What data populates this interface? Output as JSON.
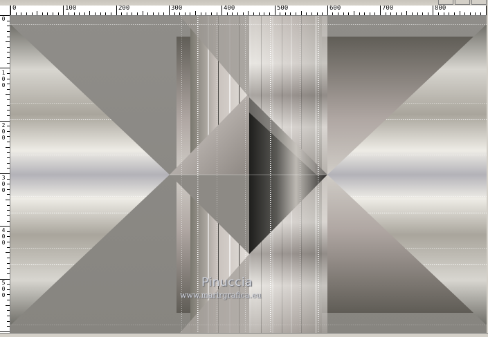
{
  "ruler": {
    "h_labels": [
      "0",
      "100",
      "200",
      "300",
      "400",
      "500",
      "600",
      "700",
      "800"
    ],
    "v_labels": [
      [
        "0"
      ],
      [
        "1",
        "0",
        "0"
      ],
      [
        "2",
        "0",
        "0"
      ],
      [
        "3",
        "0",
        "0"
      ],
      [
        "4",
        "0",
        "0"
      ],
      [
        "5",
        "0",
        "0"
      ]
    ]
  },
  "canvas": {
    "watermark_name": "Pinuccia",
    "watermark_url": "www.marirgrafica.eu",
    "colors": {
      "background": "#8a8984",
      "steel_light": "#e8e6e0",
      "steel_mid": "#b8b4ae",
      "steel_dark": "#3a3a36",
      "taupe": "#a49a96"
    }
  }
}
